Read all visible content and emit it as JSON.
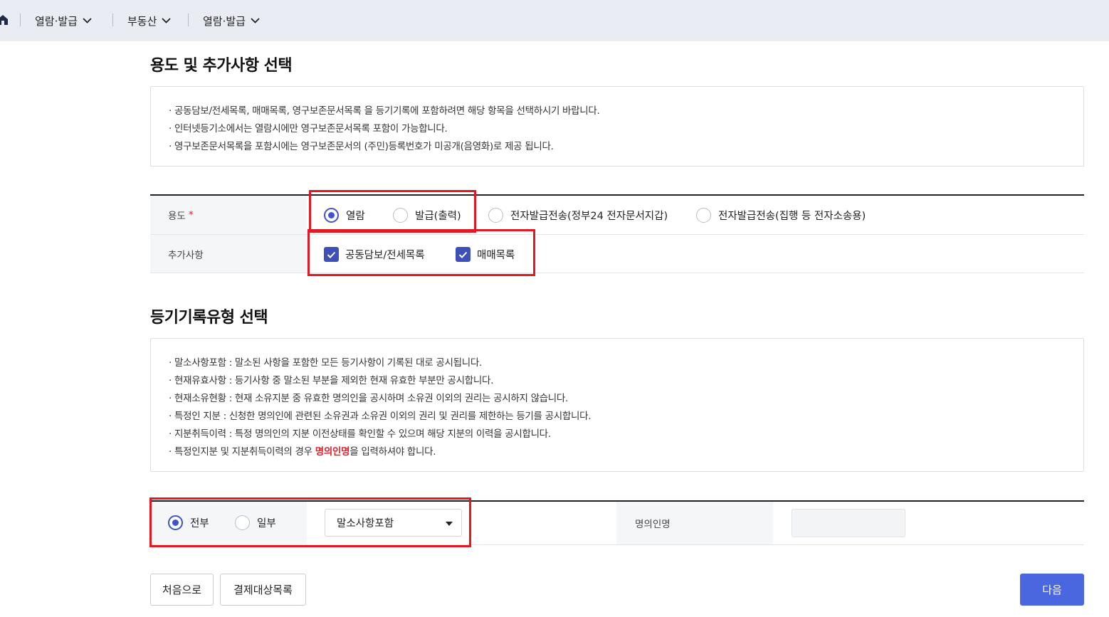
{
  "nav": {
    "home_icon": "home-icon",
    "items": [
      {
        "label": "열람·발급"
      },
      {
        "label": "부동산"
      },
      {
        "label": "열람·발급"
      }
    ]
  },
  "section1": {
    "title": "용도 및 추가사항 선택",
    "notes": [
      "· 공동담보/전세목록, 매매목록, 영구보존문서목록 을 등기기록에 포함하려면 해당 항목을 선택하시기 바랍니다.",
      "· 인터넷등기소에서는 열람시에만 영구보존문서목록 포함이 가능합니다.",
      "· 영구보존문서목록을 포함시에는 영구보존문서의 (주민)등록번호가 미공개(음영화)로 제공 됩니다."
    ],
    "purpose": {
      "label": "용도",
      "required_mark": "*",
      "options": [
        {
          "label": "열람",
          "checked": true
        },
        {
          "label": "발급(출력)",
          "checked": false
        },
        {
          "label": "전자발급전송(정부24 전자문서지갑)",
          "checked": false
        },
        {
          "label": "전자발급전송(집행 등 전자소송용)",
          "checked": false
        }
      ]
    },
    "extras": {
      "label": "추가사항",
      "options": [
        {
          "label": "공동담보/전세목록",
          "checked": true
        },
        {
          "label": "매매목록",
          "checked": true
        }
      ]
    }
  },
  "section2": {
    "title": "등기기록유형 선택",
    "notes": [
      "· 말소사항포함 : 말소된 사항을 포함한 모든 등기사항이 기록된 대로 공시됩니다.",
      "· 현재유효사항 : 등기사항 중 말소된 부분을 제외한 현재 유효한 부분만 공시합니다.",
      "· 현재소유현황 : 현재 소유지분 중 유효한 명의인을 공시하며 소유권 이외의 권리는 공시하지 않습니다.",
      "· 특정인 지분 : 신청한 명의인에 관련된 소유권과 소유권 이외의 권리 및 권리를 제한하는 등기를 공시합니다.",
      "· 지분취득이력 : 특정 명의인의 지분 이전상태를 확인할 수 있으며 해당 지분의 이력을 공시합니다."
    ],
    "last_note": {
      "prefix": "· 특정인지분 및 지분취득이력의 경우 ",
      "highlight": "명의인명",
      "suffix": "을 입력하셔야 합니다."
    },
    "scope": {
      "options": [
        {
          "label": "전부",
          "checked": true
        },
        {
          "label": "일부",
          "checked": false
        }
      ]
    },
    "record_type_select": {
      "value": "말소사항포함"
    },
    "owner_name": {
      "label": "명의인명",
      "value": ""
    }
  },
  "buttons": {
    "reset": "처음으로",
    "payment_list": "결제대상목록",
    "next": "다음"
  },
  "colors": {
    "accent": "#4054c9",
    "primary_button": "#4a67e0",
    "highlight_frame": "#e01a22",
    "required": "#e0202b"
  }
}
